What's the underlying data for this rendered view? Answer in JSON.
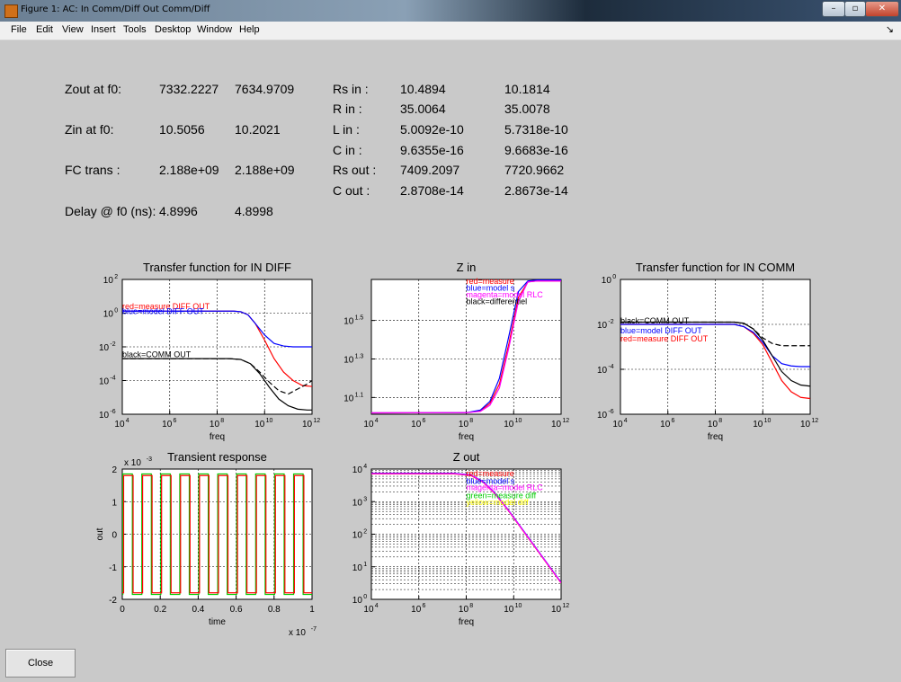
{
  "window": {
    "title": "Figure 1: AC: In Comm/Diff Out Comm/Diff",
    "minimize": "–",
    "maximize": "▫",
    "close": "✕"
  },
  "menu": [
    "File",
    "Edit",
    "View",
    "Insert",
    "Tools",
    "Desktop",
    "Window",
    "Help"
  ],
  "stats_left": [
    {
      "label": "Zout at f0:",
      "v1": "7332.2227",
      "v2": "7634.9709"
    },
    {
      "label": "Zin at f0:",
      "v1": "10.5056",
      "v2": "10.2021"
    },
    {
      "label": "FC trans :",
      "v1": "2.188e+09",
      "v2": "2.188e+09"
    },
    {
      "label": "Delay @ f0 (ns):",
      "v1": "4.8996",
      "v2": "4.8998"
    }
  ],
  "stats_right": [
    {
      "label": "Rs in :",
      "v1": "10.4894",
      "v2": "10.1814"
    },
    {
      "label": "R in :",
      "v1": "35.0064",
      "v2": "35.0078"
    },
    {
      "label": "L in :",
      "v1": "5.0092e-10",
      "v2": "5.7318e-10"
    },
    {
      "label": "C in :",
      "v1": "9.6355e-16",
      "v2": "9.6683e-16"
    },
    {
      "label": "Rs out :",
      "v1": "7409.2097",
      "v2": "7720.9662"
    },
    {
      "label": "C out :",
      "v1": "2.8708e-14",
      "v2": "2.8673e-14"
    }
  ],
  "close_label": "Close",
  "chart_data": [
    {
      "id": "tf_diff",
      "type": "line",
      "title": "Transfer function for IN DIFF",
      "xlabel": "freq",
      "ylabel": "",
      "xscale": "log",
      "yscale": "log",
      "xlim": [
        4,
        12
      ],
      "ylim": [
        -6,
        2
      ],
      "xticks": [
        4,
        6,
        8,
        10,
        12
      ],
      "yticks": [
        -6,
        -4,
        -2,
        0,
        2
      ],
      "legend_position": "inline",
      "annotations": [
        {
          "text": "red=measure DIFF OUT",
          "x": 4,
          "y": 0.25,
          "color": "#ff0000"
        },
        {
          "text": "blue=model DIFF OUT",
          "x": 4,
          "y": -0.05,
          "color": "#0000ff"
        },
        {
          "text": "black=COMM OUT",
          "x": 4,
          "y": -2.6,
          "color": "#000000"
        }
      ],
      "series": [
        {
          "color": "#ff0000",
          "style": "solid",
          "x": [
            4,
            8.7,
            9.0,
            9.3,
            9.6,
            10.0,
            10.4,
            10.8,
            11.2,
            11.6,
            12
          ],
          "y": [
            0.12,
            0.12,
            0.08,
            -0.1,
            -0.6,
            -1.6,
            -2.7,
            -3.5,
            -4.0,
            -4.3,
            -4.35
          ]
        },
        {
          "color": "#0000ff",
          "style": "solid",
          "x": [
            4,
            8.7,
            9.0,
            9.3,
            9.6,
            10.0,
            10.4,
            10.8,
            11.2,
            11.6,
            12
          ],
          "y": [
            0.12,
            0.12,
            0.08,
            -0.1,
            -0.6,
            -1.3,
            -1.8,
            -1.95,
            -2.0,
            -2.0,
            -2.0
          ]
        },
        {
          "color": "#000000",
          "style": "solid",
          "x": [
            4,
            8.5,
            9.0,
            9.4,
            9.8,
            10.2,
            10.6,
            11.0,
            11.4,
            11.8,
            12
          ],
          "y": [
            -2.7,
            -2.7,
            -2.75,
            -3.0,
            -3.6,
            -4.4,
            -5.1,
            -5.5,
            -5.7,
            -5.75,
            -5.75
          ]
        },
        {
          "color": "#000000",
          "style": "dashed",
          "x": [
            4,
            8.5,
            9.0,
            9.4,
            9.8,
            10.2,
            10.6,
            11.0,
            11.4,
            11.8,
            12
          ],
          "y": [
            -2.7,
            -2.7,
            -2.75,
            -3.0,
            -3.5,
            -4.1,
            -4.6,
            -4.8,
            -4.5,
            -4.2,
            -4.0
          ]
        }
      ]
    },
    {
      "id": "zin",
      "type": "line",
      "title": "Z in",
      "xlabel": "freq",
      "ylabel": "",
      "xscale": "log",
      "yscale": "log",
      "xlim": [
        4,
        12
      ],
      "ylim": [
        1.013,
        1.713
      ],
      "xticks": [
        4,
        6,
        8,
        10,
        12
      ],
      "yticks": [
        1.1,
        1.3,
        1.5
      ],
      "legend_position": "top-right",
      "annotations": [
        {
          "text": "red=measure",
          "x": 8.0,
          "y": 1.69,
          "color": "#ff0000"
        },
        {
          "text": "blue=model s",
          "x": 8.0,
          "y": 1.655,
          "color": "#0000ff"
        },
        {
          "text": "magenta=model RLC",
          "x": 8.0,
          "y": 1.62,
          "color": "#ff00ff"
        },
        {
          "text": "black=differentiel",
          "x": 8.0,
          "y": 1.585,
          "color": "#000000"
        }
      ],
      "series": [
        {
          "color": "#ff0000",
          "style": "solid",
          "x": [
            4,
            8.0,
            8.6,
            9.0,
            9.4,
            9.8,
            10.2,
            10.6,
            11.0,
            12
          ],
          "y": [
            1.02,
            1.021,
            1.03,
            1.07,
            1.17,
            1.38,
            1.62,
            1.7,
            1.705,
            1.705
          ]
        },
        {
          "color": "#0000ff",
          "style": "solid",
          "x": [
            4,
            8.0,
            8.6,
            9.0,
            9.4,
            9.8,
            10.2,
            10.6,
            11.0,
            12
          ],
          "y": [
            1.02,
            1.021,
            1.035,
            1.08,
            1.2,
            1.42,
            1.65,
            1.705,
            1.71,
            1.71
          ]
        },
        {
          "color": "#ff00ff",
          "style": "solid",
          "x": [
            4,
            8.0,
            8.6,
            9.0,
            9.4,
            9.8,
            10.2,
            10.6,
            11.0,
            12
          ],
          "y": [
            1.02,
            1.021,
            1.028,
            1.06,
            1.15,
            1.36,
            1.6,
            1.7,
            1.705,
            1.705
          ]
        }
      ]
    },
    {
      "id": "tf_comm",
      "type": "line",
      "title": "Transfer function for IN COMM",
      "xlabel": "freq",
      "ylabel": "",
      "xscale": "log",
      "yscale": "log",
      "xlim": [
        4,
        12
      ],
      "ylim": [
        -6,
        0
      ],
      "xticks": [
        4,
        6,
        8,
        10,
        12
      ],
      "yticks": [
        -6,
        -4,
        -2,
        0
      ],
      "legend_position": "inline",
      "annotations": [
        {
          "text": "black=COMM OUT",
          "x": 4,
          "y": -1.95,
          "color": "#000000"
        },
        {
          "text": "blue=model DIFF OUT",
          "x": 4,
          "y": -2.4,
          "color": "#0000ff"
        },
        {
          "text": "red=measure DIFF OUT",
          "x": 4,
          "y": -2.75,
          "color": "#ff0000"
        }
      ],
      "series": [
        {
          "color": "#ff0000",
          "style": "solid",
          "x": [
            4,
            8.8,
            9.2,
            9.6,
            10.0,
            10.4,
            10.8,
            11.2,
            11.6,
            12
          ],
          "y": [
            -2.0,
            -2.0,
            -2.1,
            -2.4,
            -2.9,
            -3.7,
            -4.5,
            -5.0,
            -5.25,
            -5.3
          ]
        },
        {
          "color": "#0000ff",
          "style": "solid",
          "x": [
            4,
            8.8,
            9.2,
            9.6,
            10.0,
            10.4,
            10.8,
            11.2,
            11.6,
            12
          ],
          "y": [
            -2.0,
            -2.0,
            -2.1,
            -2.35,
            -2.8,
            -3.4,
            -3.75,
            -3.85,
            -3.88,
            -3.88
          ]
        },
        {
          "color": "#000000",
          "style": "solid",
          "x": [
            4,
            8.8,
            9.2,
            9.6,
            10.0,
            10.4,
            10.8,
            11.2,
            11.6,
            12
          ],
          "y": [
            -1.9,
            -1.9,
            -1.95,
            -2.2,
            -2.7,
            -3.4,
            -4.1,
            -4.5,
            -4.7,
            -4.75
          ]
        },
        {
          "color": "#000000",
          "style": "dashed",
          "x": [
            4,
            8.8,
            9.2,
            9.6,
            10.0,
            10.4,
            10.8,
            11.2,
            11.6,
            12
          ],
          "y": [
            -1.9,
            -1.9,
            -1.95,
            -2.2,
            -2.6,
            -2.85,
            -2.95,
            -2.95,
            -2.95,
            -2.95
          ]
        }
      ]
    },
    {
      "id": "transient",
      "type": "line",
      "title": "Transient response",
      "xlabel": "time",
      "ylabel": "out",
      "xscale": "linear",
      "yscale": "linear",
      "xlim": [
        0,
        1
      ],
      "ylim": [
        -2,
        2
      ],
      "xticks": [
        0,
        0.2,
        0.4,
        0.6,
        0.8,
        1
      ],
      "yticks": [
        -2,
        -1,
        0,
        1,
        2
      ],
      "x_multiplier": "x 10",
      "x_multiplier_exp": "-7",
      "y_multiplier": "x 10",
      "y_multiplier_exp": "-3",
      "period": 0.1,
      "green_high": 1.85,
      "green_low": -1.85,
      "red_high": 1.8,
      "red_low": -1.8,
      "series": [
        {
          "color": "#00cc00",
          "name": "green"
        },
        {
          "color": "#ff0000",
          "name": "red"
        }
      ]
    },
    {
      "id": "zout",
      "type": "line",
      "title": "Z out",
      "xlabel": "freq",
      "ylabel": "",
      "xscale": "log",
      "yscale": "log",
      "xlim": [
        4,
        12
      ],
      "ylim": [
        0,
        4
      ],
      "xticks": [
        4,
        6,
        8,
        10,
        12
      ],
      "yticks": [
        0,
        1,
        2,
        3,
        4
      ],
      "legend_position": "top-right",
      "annotations": [
        {
          "text": "red=measure",
          "x": 8.0,
          "y": 3.78,
          "color": "#ff0000"
        },
        {
          "text": "blue=model s",
          "x": 8.0,
          "y": 3.55,
          "color": "#0000ff"
        },
        {
          "text": "magenta=model RLC",
          "x": 8.0,
          "y": 3.35,
          "color": "#ff00ff"
        },
        {
          "text": "green=measure diff",
          "x": 8.0,
          "y": 3.1,
          "color": "#00cc00"
        },
        {
          "text": "yellow=model diff",
          "x": 8.0,
          "y": 2.9,
          "color": "#ffff00"
        }
      ],
      "series": [
        {
          "color": "#ff0000",
          "style": "solid",
          "x": [
            4,
            7.5,
            8.2,
            8.7,
            9.2,
            9.8,
            10.4,
            11.0,
            11.6,
            12
          ],
          "y": [
            3.85,
            3.85,
            3.8,
            3.6,
            3.25,
            2.7,
            2.1,
            1.5,
            0.9,
            0.5
          ]
        },
        {
          "color": "#0000ff",
          "style": "solid",
          "x": [
            4,
            7.5,
            8.2,
            8.7,
            9.2,
            9.8,
            10.4,
            11.0,
            11.6,
            12
          ],
          "y": [
            3.87,
            3.87,
            3.82,
            3.62,
            3.27,
            2.72,
            2.12,
            1.52,
            0.92,
            0.52
          ]
        },
        {
          "color": "#ff00ff",
          "style": "solid",
          "x": [
            4,
            7.5,
            8.2,
            8.7,
            9.2,
            9.8,
            10.4,
            11.0,
            11.6,
            12
          ],
          "y": [
            3.86,
            3.86,
            3.81,
            3.61,
            3.26,
            2.71,
            2.11,
            1.51,
            0.91,
            0.51
          ]
        }
      ]
    }
  ]
}
